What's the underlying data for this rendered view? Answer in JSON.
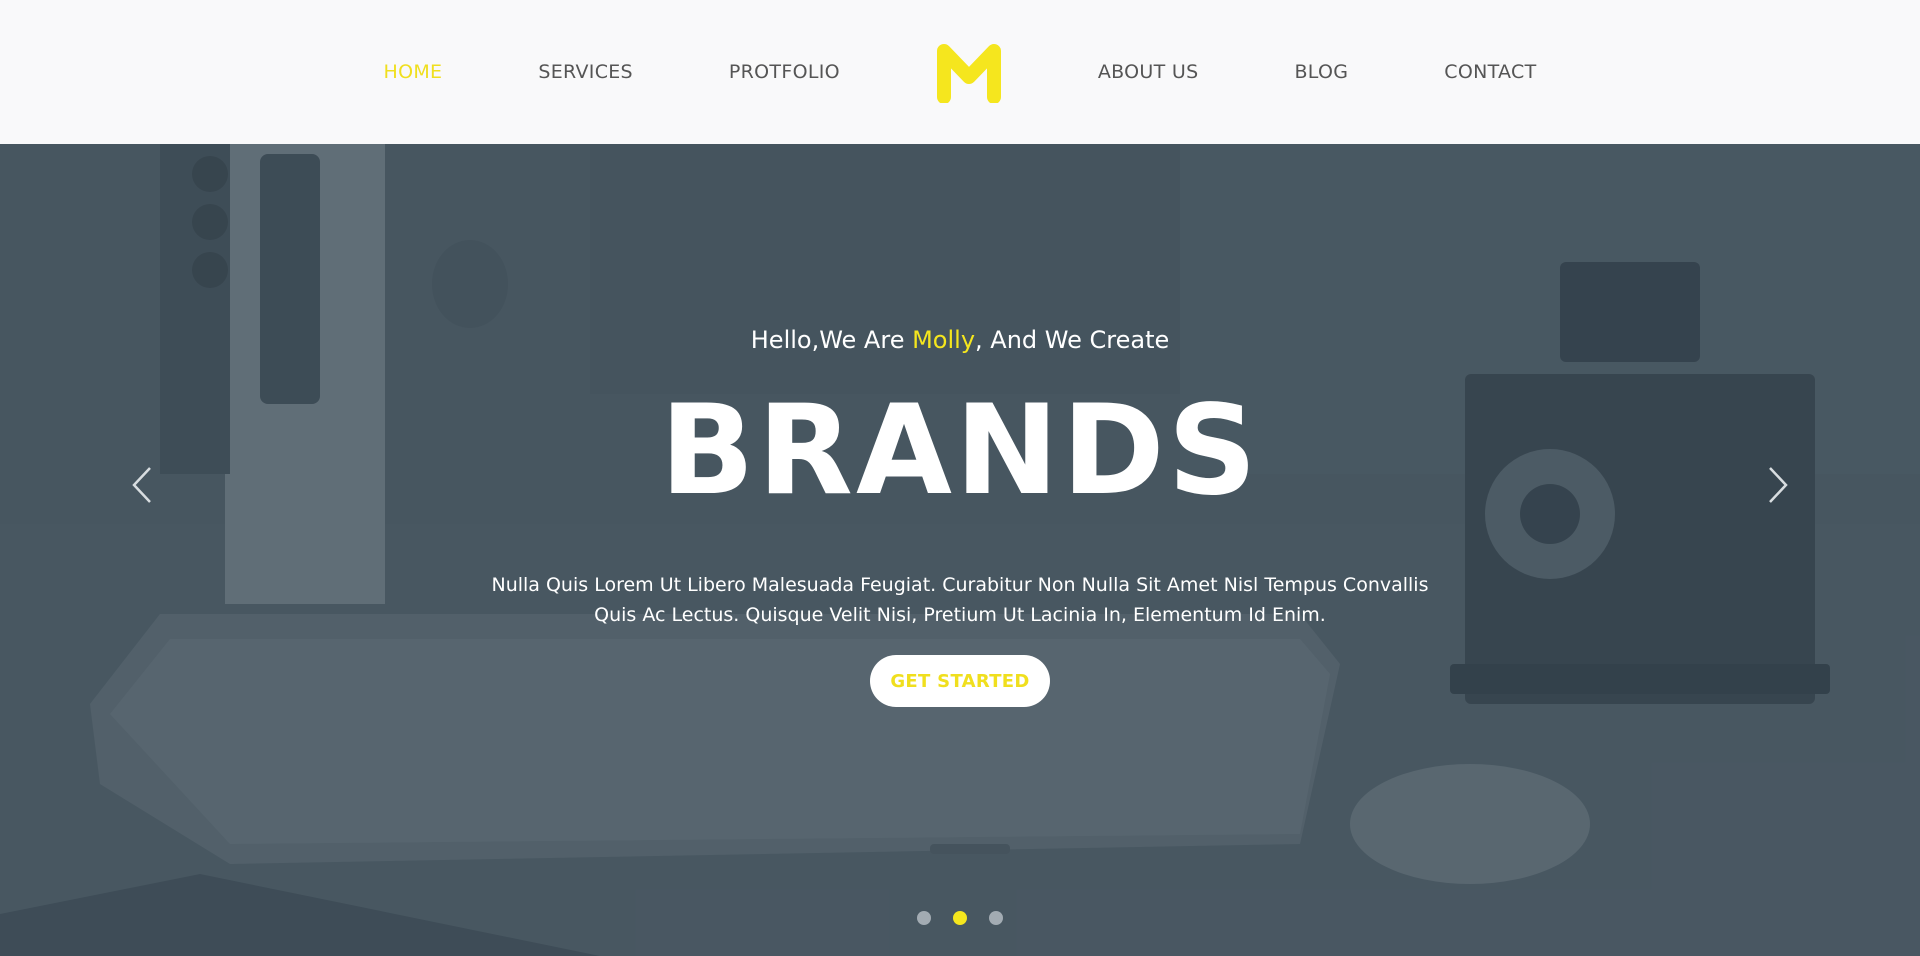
{
  "nav": {
    "left": [
      {
        "label": "HOME",
        "active": true
      },
      {
        "label": "SERVICES",
        "active": false
      },
      {
        "label": "PROTFOLIO",
        "active": false
      }
    ],
    "right": [
      {
        "label": "ABOUT US",
        "active": false
      },
      {
        "label": "BLOG",
        "active": false
      },
      {
        "label": "CONTACT",
        "active": false
      }
    ],
    "logo_icon": "m-logo-icon"
  },
  "hero": {
    "intro_before": "Hello,We Are ",
    "intro_highlight": "Molly",
    "intro_after": ", And We Create",
    "headline": "BRANDS",
    "description": "Nulla Quis Lorem Ut Libero Malesuada Feugiat. Curabitur Non Nulla Sit Amet Nisl Tempus Convallis Quis Ac Lectus. Quisque Velit Nisi, Pretium Ut Lacinia In, Elementum Id Enim.",
    "cta_label": "GET STARTED",
    "prev_icon": "chevron-left-icon",
    "next_icon": "chevron-right-icon",
    "slides_count": 3,
    "active_slide": 2
  },
  "colors": {
    "accent": "#f5e61e",
    "nav_text": "#555555",
    "header_bg": "#f9f9fa",
    "hero_overlay": "#3e4e5a"
  }
}
